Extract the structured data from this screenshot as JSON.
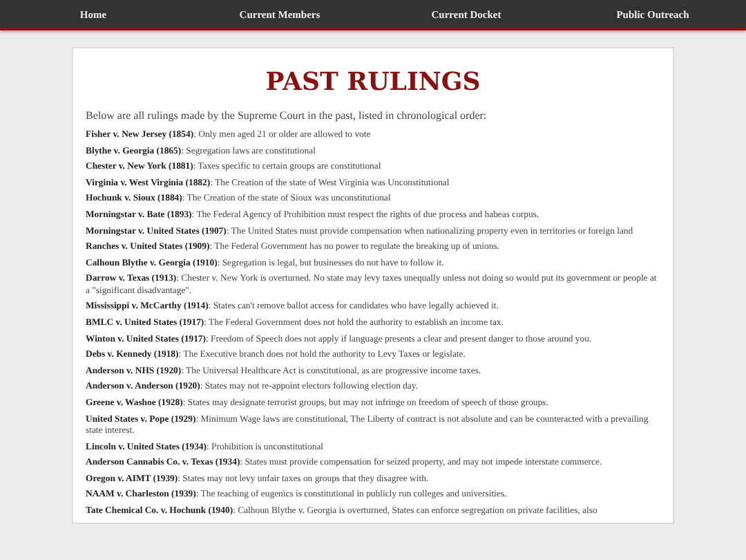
{
  "nav": [
    {
      "label": "Home"
    },
    {
      "label": "Current Members"
    },
    {
      "label": "Current Docket"
    },
    {
      "label": "Public Outreach"
    }
  ],
  "title": "PAST RULINGS",
  "intro": "Below are all rulings made by the Supreme Court in the past, listed in chronological order:",
  "rulings": [
    "**Fisher v. New Jersey (1854)**: Only men aged 21 or older are allowed to vote",
    "**Blythe v. Georgia (1865)**: Segregation laws are constitutional",
    "**Chester v. New York (1881)**: Taxes specific to certain groups are constitutional",
    "**Virginia v. West Virginia (1882)**: The Creation of the state of West Virginia was Unconstitutional",
    "**Hochunk v. Sioux (1884)**: The Creation of the state of Sioux was unconstitutional",
    "**Morningstar v. Bate (1893)**: The Federal Agency of Prohibition must respect the rights of due process and habeas corpus.",
    "**Morningstar v. United States (1907)**: The United States must provide compensation when nationalizing property even in territories or foreign land",
    "**Ranches v. United States (1909)**: The Federal Government has no power to regulate the breaking up of unions.",
    "**Calhoun Blythe v. Georgia (1910)**: Segregation is legal, but businesses do not have to follow it.",
    "**Darrow v. Texas (1913)**: Chester v. New York is overturned. No state may levy taxes unequally unless not doing so would put its government or people at a \"significant disadvantage\".",
    "**Mississippi v. McCarthy (1914)**: States can't remove ballot access for candidates who have legally achieved it.",
    "**BMLC v. United States (1917)**: The Federal Government does not hold the authority to establish an income tax.",
    "**Winton v. United States (1917)**: Freedom of Speech does not apply if language presents a clear and present danger to those around you.",
    "**Debs v. Kennedy (1918)**: The Executive branch does not hold the authority to Levy Taxes or legislate.",
    "**Anderson v. NHS (1920)**: The Universal Healthcare Act is constitutional, as are progressive income taxes.",
    "**Anderson v. Anderson (1920)**: States may not re-appoint electors following election day.",
    "**Greene v. Washoe (1928)**: States may designate terrorist groups, but may not infringe on freedom of speech of those groups.",
    "**United States v. Pope (1929)**: Minimum Wage laws are constitutional, The Liberty of contract is not absolute and can be counteracted with a prevailing state interest.",
    "**Lincoln v. United States (1934)**: Prohibition is unconstitutional",
    "**Anderson Cannabis Co. v. Texas (1934)**: States must provide compensation for seized property, and may not impede interstate commerce.",
    "**Oregon v. AIMT (1939)**: States may not levy unfair taxes on groups that they disagree with.",
    "**NAAM v. Charleston (1939)**: The teaching of eugenics is constitutional in publicly run colleges and universities.",
    "**Tate Chemical Co. v. Hochunk (1940)**: Calhoun Blythe v. Georgia is overturned, States can enforce segregation on private facilities, also"
  ]
}
